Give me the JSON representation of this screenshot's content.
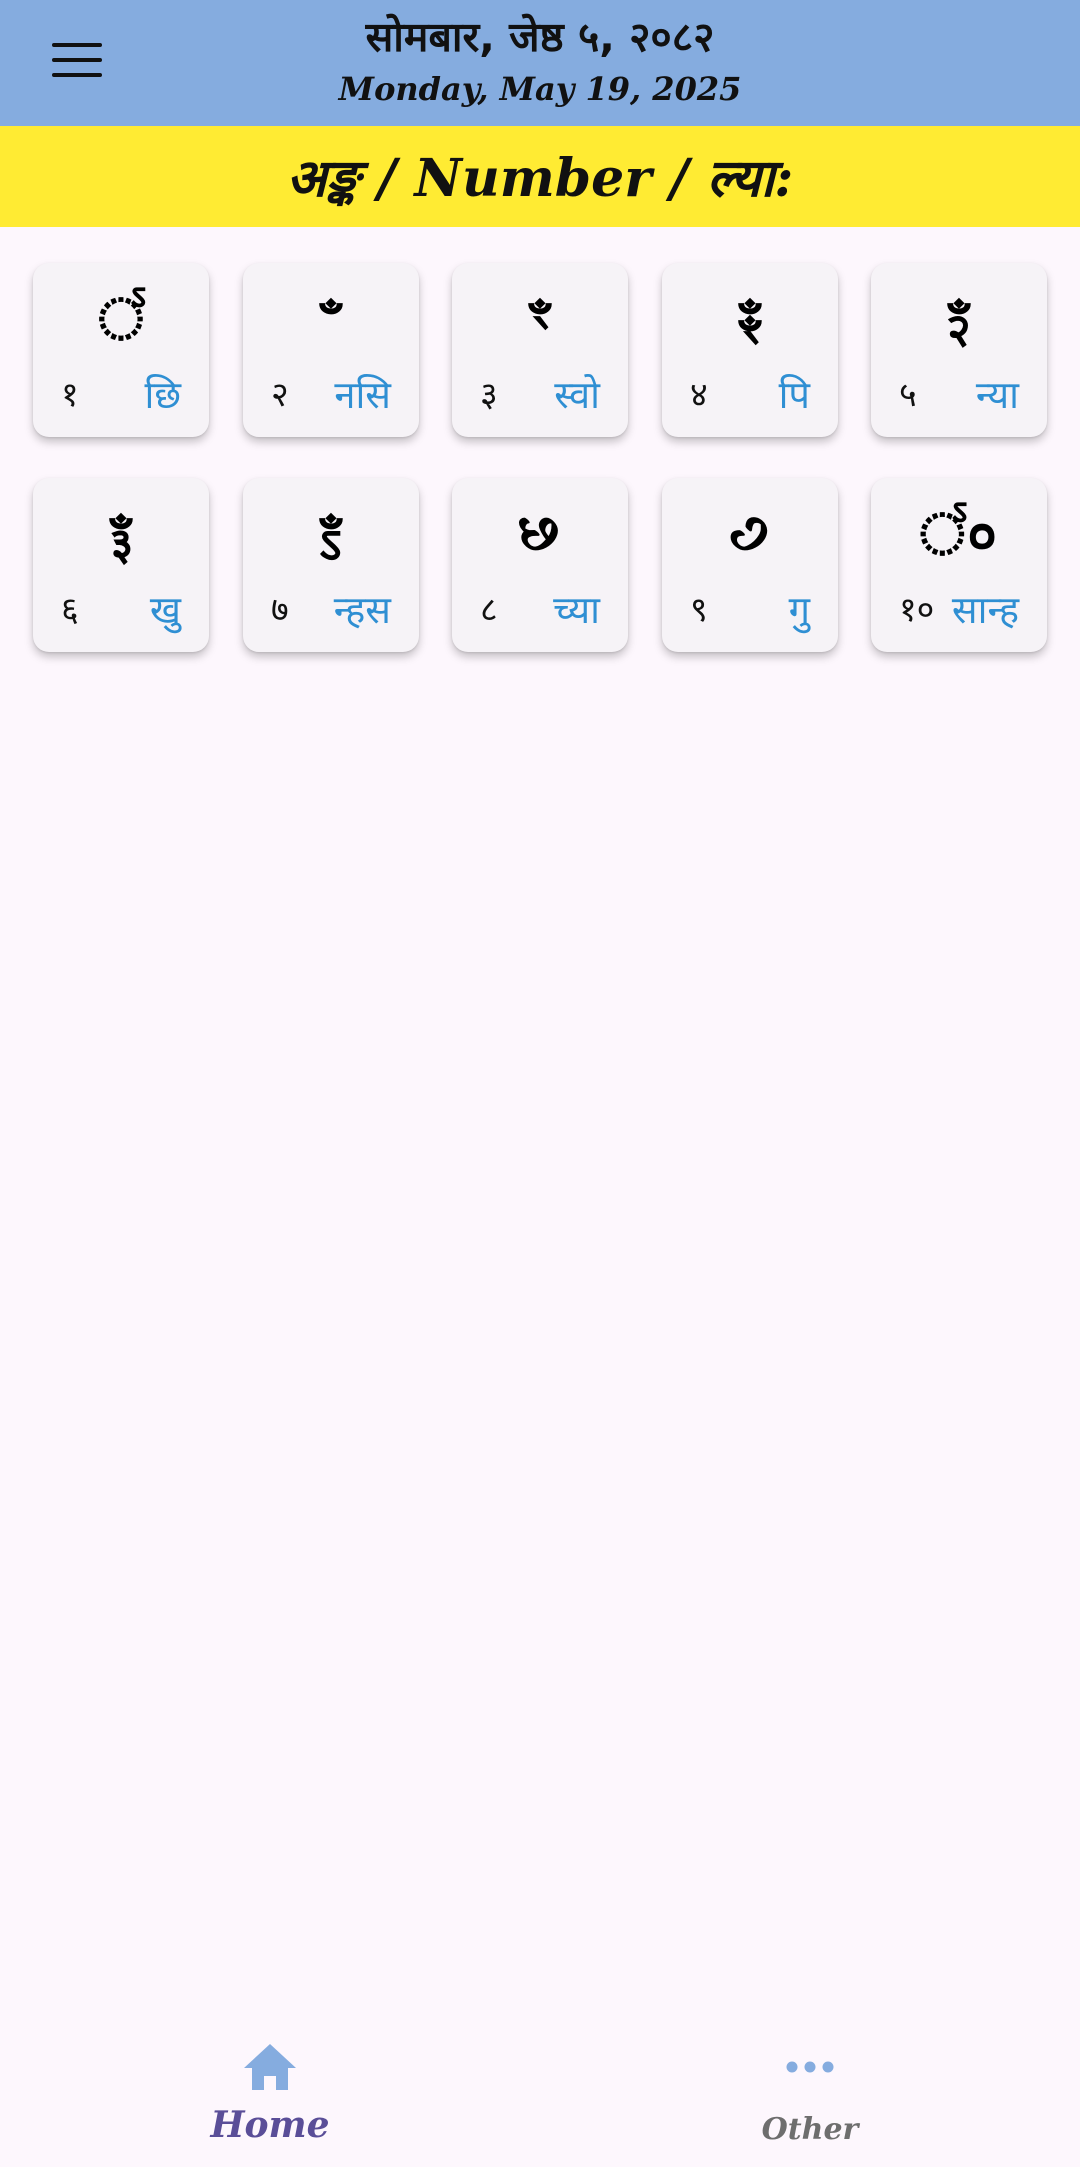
{
  "header": {
    "date_np": "सोमबार, जेष्ठ ५, २०८२",
    "date_en": "Monday, May 19, 2025"
  },
  "banner": {
    "title": "अङ्क / Number / ल्या:"
  },
  "numbers": [
    {
      "glyph": "꣱",
      "digit": "१",
      "word": "छि"
    },
    {
      "glyph": "ꣲ",
      "digit": "२",
      "word": "नसि"
    },
    {
      "glyph": "ꣳ",
      "digit": "३",
      "word": "स्वो"
    },
    {
      "glyph": "ꣴ",
      "digit": "४",
      "word": "पि"
    },
    {
      "glyph": "ꣵ",
      "digit": "५",
      "word": "न्या"
    },
    {
      "glyph": "ꣶ",
      "digit": "६",
      "word": "खु"
    },
    {
      "glyph": "ꣷ",
      "digit": "७",
      "word": "न्हस"
    },
    {
      "glyph": "꣸",
      "digit": "८",
      "word": "च्या"
    },
    {
      "glyph": "꣹",
      "digit": "९",
      "word": "गु"
    },
    {
      "glyph": "꣱०",
      "digit": "१०",
      "word": "सान्ह"
    }
  ],
  "bottom_nav": {
    "items": [
      {
        "label": "Home",
        "icon": "home-icon",
        "active": true
      },
      {
        "label": "Other",
        "icon": "more-horizontal-icon",
        "active": false
      }
    ]
  },
  "colors": {
    "topbar": "#85acdf",
    "banner": "#ffeb33",
    "accent_word": "#2f8fd3",
    "nav_active": "#5a4e98",
    "nav_icon": "#85acdf"
  }
}
